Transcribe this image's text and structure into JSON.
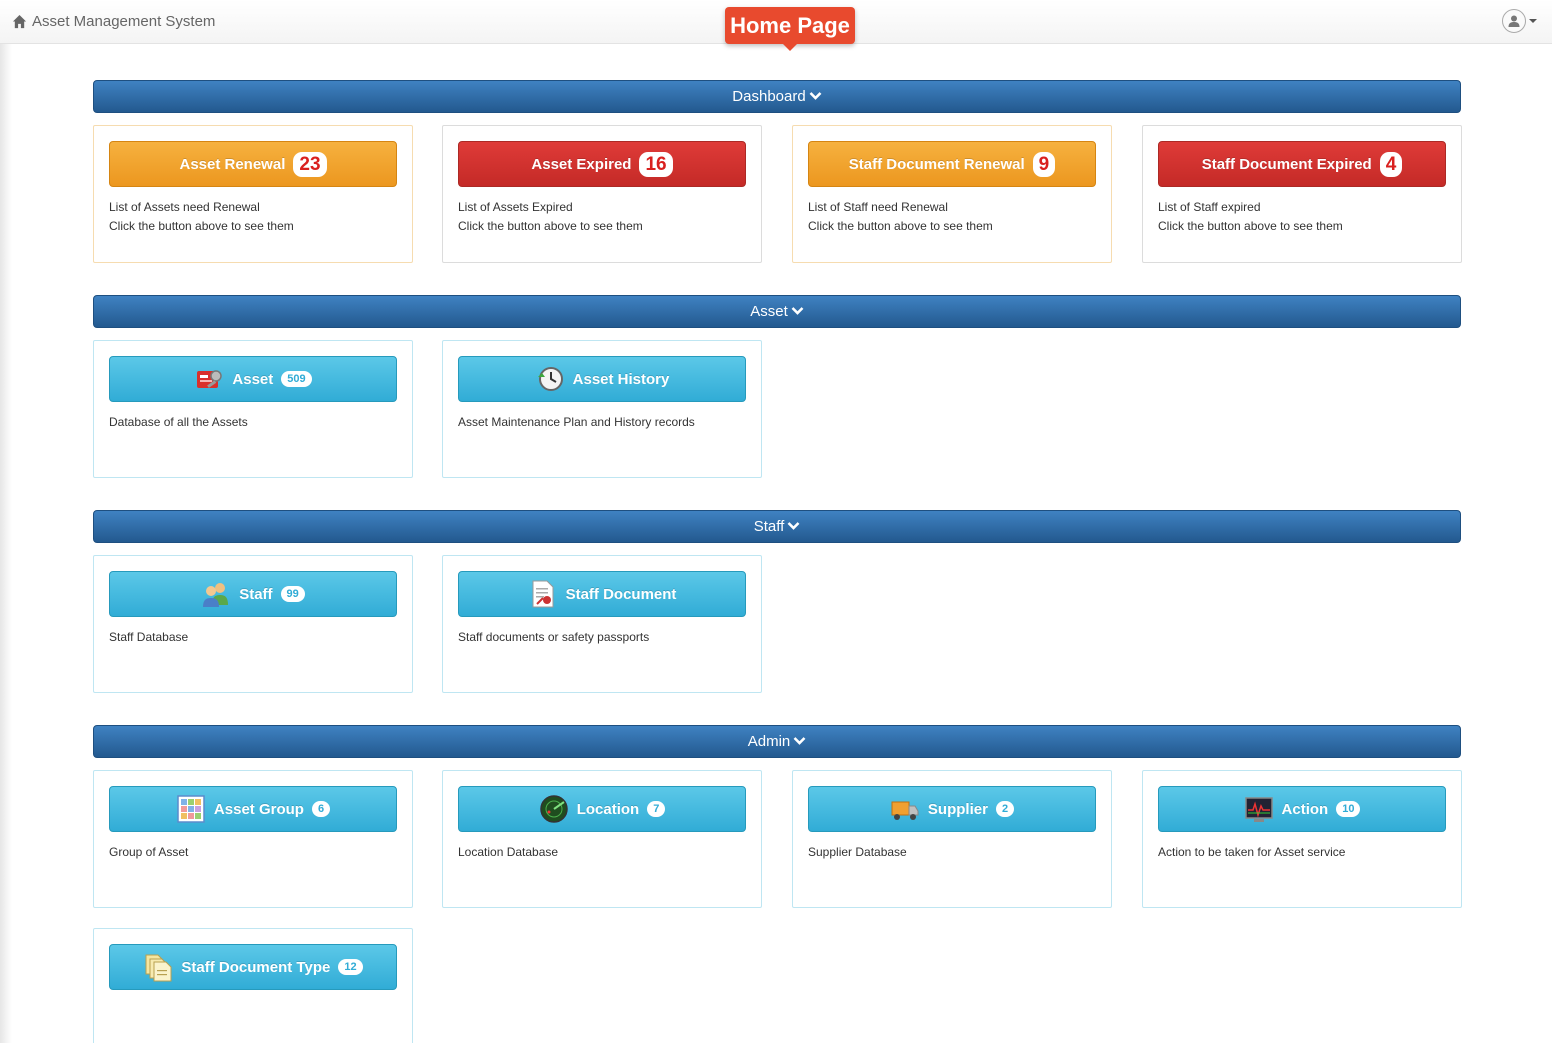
{
  "navbar": {
    "brand": "Asset Management System",
    "home_tag": "Home Page"
  },
  "sections": {
    "dashboard": "Dashboard",
    "asset": "Asset",
    "staff": "Staff",
    "admin": "Admin"
  },
  "dashboard": [
    {
      "label": "Asset Renewal",
      "count": "23",
      "line1": "List of Assets need Renewal",
      "line2": "Click the button above to see them"
    },
    {
      "label": "Asset Expired",
      "count": "16",
      "line1": "List of Assets Expired",
      "line2": "Click the button above to see them"
    },
    {
      "label": "Staff Document Renewal",
      "count": "9",
      "line1": "List of Staff need Renewal",
      "line2": "Click the button above to see them"
    },
    {
      "label": "Staff Document Expired",
      "count": "4",
      "line1": "List of Staff expired",
      "line2": "Click the button above to see them"
    }
  ],
  "asset": [
    {
      "label": "Asset",
      "count": "509",
      "icon": "asset-icon",
      "desc": "Database of all the Assets"
    },
    {
      "label": "Asset History",
      "icon": "clock-icon",
      "desc": "Asset Maintenance Plan and History records"
    }
  ],
  "staff": [
    {
      "label": "Staff",
      "count": "99",
      "icon": "people-icon",
      "desc": "Staff Database"
    },
    {
      "label": "Staff Document",
      "icon": "document-icon",
      "desc": "Staff documents or safety passports"
    }
  ],
  "admin": [
    {
      "label": "Asset Group",
      "count": "6",
      "icon": "grid-icon",
      "desc": "Group of Asset"
    },
    {
      "label": "Location",
      "count": "7",
      "icon": "radar-icon",
      "desc": "Location Database"
    },
    {
      "label": "Supplier",
      "count": "2",
      "icon": "truck-icon",
      "desc": "Supplier Database"
    },
    {
      "label": "Action",
      "count": "10",
      "icon": "monitor-icon",
      "desc": "Action to be taken for Asset service"
    },
    {
      "label": "Staff Document Type",
      "count": "12",
      "icon": "documents-icon",
      "desc": ""
    }
  ],
  "colors": {
    "section_header": "#2f6ea9",
    "orange": "#ec971f",
    "red": "#c9302c",
    "blue": "#31acd6",
    "home_tag": "#e84a2e"
  }
}
